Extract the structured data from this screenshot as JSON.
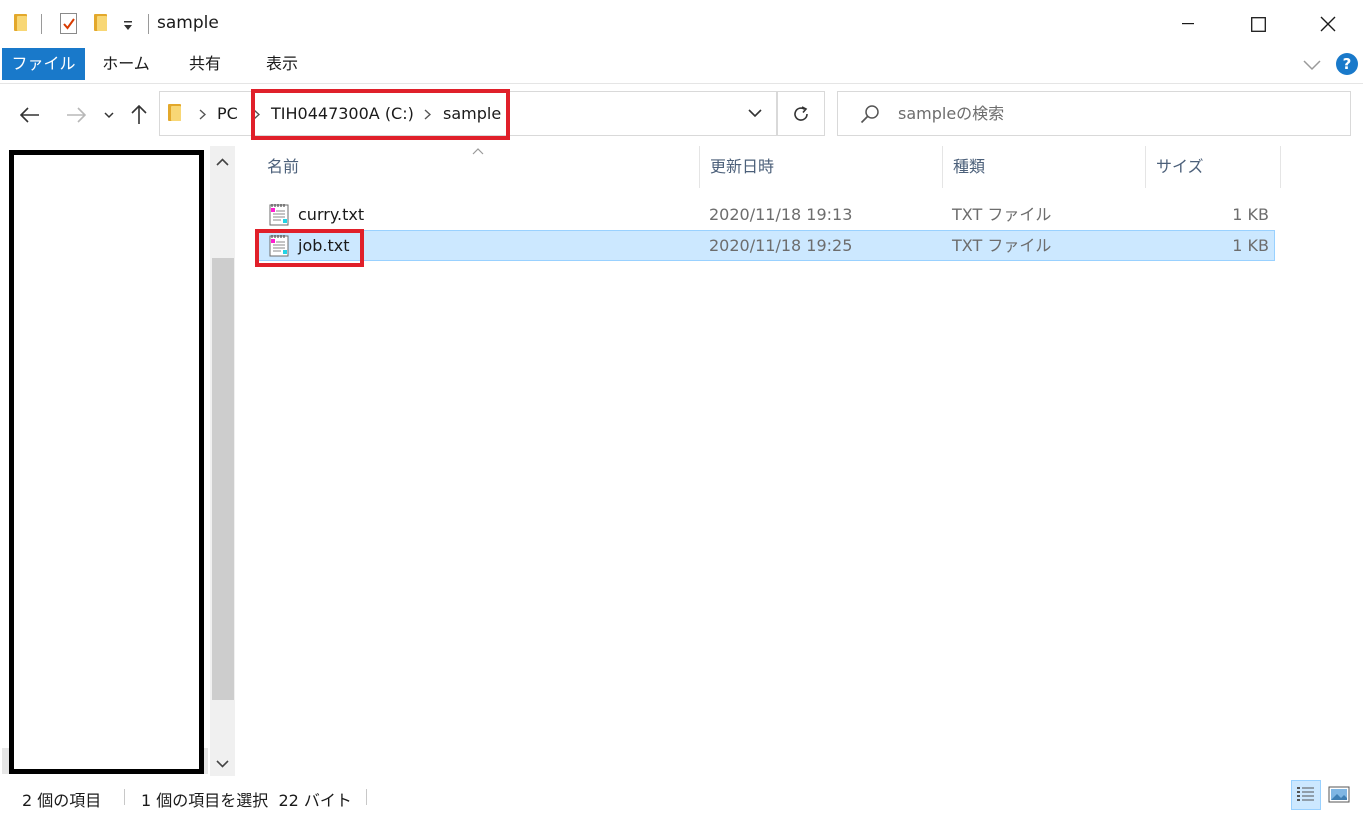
{
  "window": {
    "title": "sample",
    "quick_access": [
      "folder-icon",
      "properties-icon",
      "new-folder-icon",
      "dropdown-icon"
    ]
  },
  "ribbon": {
    "tabs": [
      {
        "label": "ファイル",
        "active": true
      },
      {
        "label": "ホーム",
        "active": false
      },
      {
        "label": "共有",
        "active": false
      },
      {
        "label": "表示",
        "active": false
      }
    ],
    "help_label": "?"
  },
  "address": {
    "breadcrumbs": [
      "PC",
      "TIH0447300A (C:)",
      "sample"
    ]
  },
  "search": {
    "placeholder": "sampleの検索"
  },
  "columns": [
    {
      "label": "名前",
      "sorted": "ascending"
    },
    {
      "label": "更新日時"
    },
    {
      "label": "種類"
    },
    {
      "label": "サイズ"
    }
  ],
  "files": [
    {
      "name": "curry.txt",
      "modified": "2020/11/18 19:13",
      "type": "TXT ファイル",
      "size": "1 KB",
      "selected": false
    },
    {
      "name": "job.txt",
      "modified": "2020/11/18 19:25",
      "type": "TXT ファイル",
      "size": "1 KB",
      "selected": true
    }
  ],
  "status": {
    "item_count": "2 個の項目",
    "selection": "1 個の項目を選択  22 バイト"
  },
  "colors": {
    "accent": "#1979ca",
    "selection_bg": "#cce8ff",
    "selection_border": "#99d1ff",
    "highlight_red": "#e0202a"
  }
}
